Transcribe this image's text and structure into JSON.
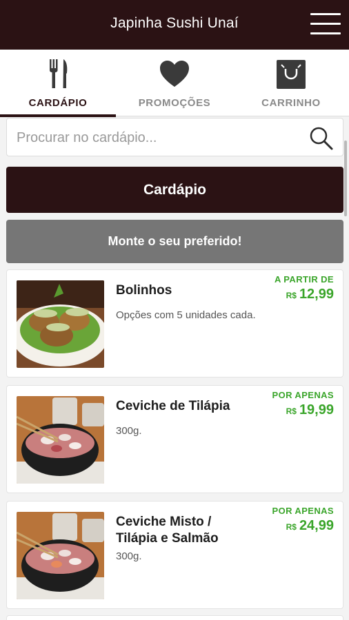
{
  "header": {
    "title": "Japinha Sushi Unaí",
    "menu_icon": "hamburger-menu-icon"
  },
  "tabs": [
    {
      "label": "CARDÁPIO",
      "icon": "fork-knife-icon",
      "active": true
    },
    {
      "label": "PROMOÇÕES",
      "icon": "heart-icon",
      "active": false
    },
    {
      "label": "CARRINHO",
      "icon": "shopping-bag-icon",
      "active": false
    }
  ],
  "search": {
    "placeholder": "Procurar no cardápio...",
    "value": "",
    "icon": "search-icon"
  },
  "buttons": {
    "menu": "Cardápio",
    "build": "Monte o seu preferido!"
  },
  "items": [
    {
      "name": "Bolinhos",
      "desc": "Opções com 5 unidades cada.",
      "price_label": "A PARTIR DE",
      "currency": "R$",
      "price": "12,99",
      "image": "bolinhos-photo"
    },
    {
      "name": "Ceviche de Tilápia",
      "desc": "300g.",
      "price_label": "POR APENAS",
      "currency": "R$",
      "price": "19,99",
      "image": "ceviche-photo"
    },
    {
      "name": "Ceviche Misto / Tilápia e Salmão",
      "desc": "300g.",
      "price_label": "POR APENAS",
      "currency": "R$",
      "price": "24,99",
      "image": "ceviche-photo"
    }
  ],
  "colors": {
    "brand": "#2b1214",
    "secondary_button": "#767676",
    "price": "#3aa52a"
  }
}
